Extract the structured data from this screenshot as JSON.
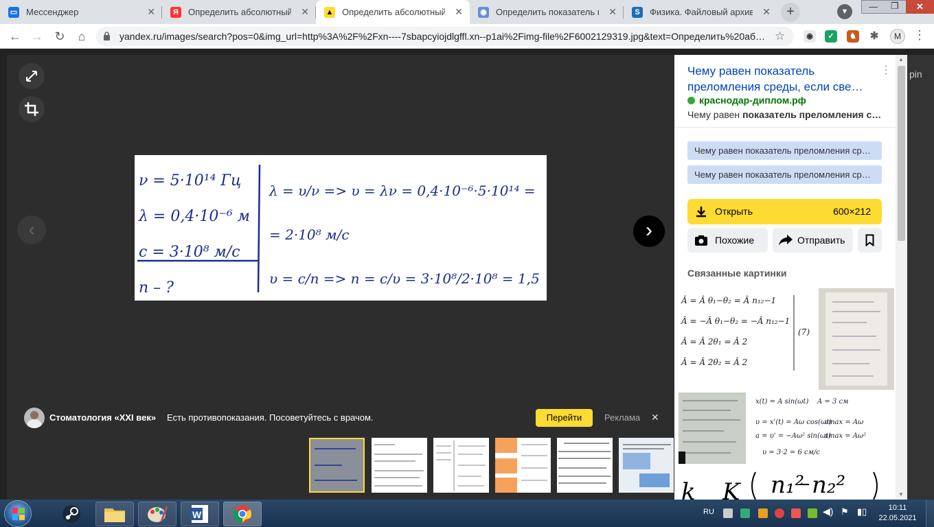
{
  "tabs": [
    {
      "title": "Мессенджер",
      "icon": "messenger-icon"
    },
    {
      "title": "Определить абсолютный пок",
      "icon": "yandex-icon"
    },
    {
      "title": "Определить абсолютный пок",
      "icon": "yandex-images-icon",
      "active": true
    },
    {
      "title": "Определить показатель прел",
      "icon": "owl-icon"
    },
    {
      "title": "Физика. Файловый архив СШ",
      "icon": "s-icon"
    }
  ],
  "url": "yandex.ru/images/search?pos=0&img_url=http%3A%2F%2Fxn----7sbapcyiojdlgffl.xn--p1ai%2Fimg-file%2F6002129319.jpg&text=Определить%20аб…",
  "profile_initial": "M",
  "handwriting": {
    "left": [
      "ν = 5·10¹⁴ Гц",
      "λ = 0,4·10⁻⁶ м",
      "c = 3·10⁸ м/с",
      "n – ?"
    ],
    "right": [
      "λ = υ/ν => υ = λν = 0,4·10⁻⁶·5·10¹⁴ =",
      "= 2·10⁸ м/с",
      "υ = c/n => n = c/υ = 3·10⁸/2·10⁸ = 1,5"
    ]
  },
  "ad": {
    "name": "Стоматология «XXI век»",
    "text": "Есть противопоказания. Посоветуйтесь с врачом.",
    "go": "Перейти",
    "label": "Реклама"
  },
  "panel": {
    "title": "Чему равен показатель преломления среды, если све…",
    "site": "краснодар-диплом.рф",
    "snippet_plain": "Чему равен ",
    "snippet_bold": "показатель преломления с…",
    "suggestions": [
      "Чему равен показатель преломления ср…",
      "Чему равен показатель преломления ср…"
    ],
    "open_label": "Открыть",
    "open_size": "600×212",
    "similar_label": "Похожие",
    "share_label": "Отправить",
    "related_title": "Связанные картинки",
    "behind_text": "pin"
  },
  "tray": {
    "lang": "RU",
    "time": "10:11",
    "date": "22.05.2021"
  }
}
